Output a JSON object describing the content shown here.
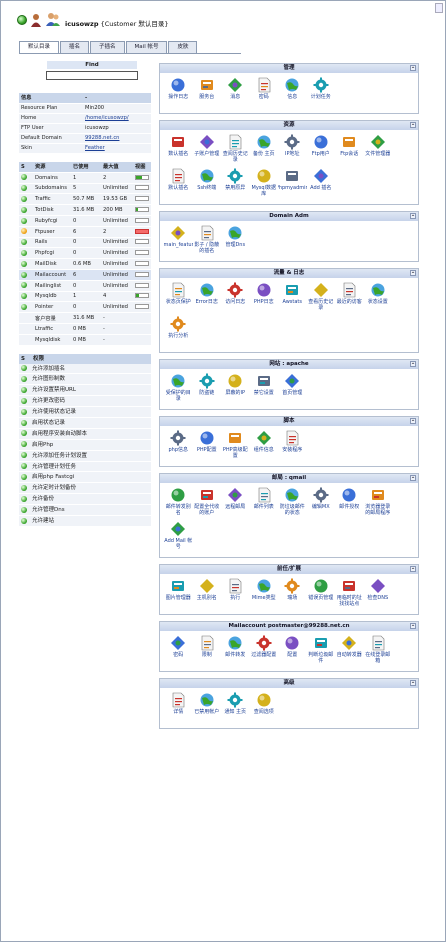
{
  "header": {
    "username": "icusowzp",
    "subtitle": "{Customer 默认目录}"
  },
  "tabs": [
    "默认目录",
    "插名",
    "子插名",
    "Mail 帐号",
    "皮肤"
  ],
  "find": {
    "label": "Find",
    "value": ""
  },
  "info": {
    "header": [
      "信息",
      "-"
    ],
    "rows": [
      [
        "Resource Plan",
        "Min200"
      ],
      [
        "Home",
        "/home/icusowzp/"
      ],
      [
        "FTP User",
        "icusowzp"
      ],
      [
        "Default Domain",
        "99288.net.cn"
      ],
      [
        "Skin",
        "Feather"
      ]
    ]
  },
  "resources": {
    "header": [
      "S",
      "资源",
      "已使用",
      "最大值",
      "视图"
    ],
    "rows": [
      {
        "s": "g",
        "name": "Domains",
        "used": "1",
        "max": "2",
        "bar": 0.5
      },
      {
        "s": "g",
        "name": "Subdomains",
        "used": "5",
        "max": "Unlimited",
        "bar": 0
      },
      {
        "s": "g",
        "name": "Traffic",
        "used": "50.7 MB",
        "max": "19.53 GB",
        "bar": 0
      },
      {
        "s": "g",
        "name": "TotDisk",
        "used": "31.6 MB",
        "max": "200 MB",
        "bar": 0.15
      },
      {
        "s": "g",
        "name": "Rubyfcgi",
        "used": "0",
        "max": "Unlimited",
        "bar": 0
      },
      {
        "s": "o",
        "name": "Ftpuser",
        "used": "6",
        "max": "2",
        "bar": 1
      },
      {
        "s": "g",
        "name": "Rails",
        "used": "0",
        "max": "Unlimited",
        "bar": 0
      },
      {
        "s": "g",
        "name": "Phpfcgi",
        "used": "0",
        "max": "Unlimited",
        "bar": 0
      },
      {
        "s": "g",
        "name": "MailDisk",
        "used": "0.6 MB",
        "max": "Unlimited",
        "bar": 0
      },
      {
        "s": "g",
        "name": "Mailaccount",
        "used": "6",
        "max": "Unlimited",
        "bar": 0
      },
      {
        "s": "g",
        "name": "Mailinglist",
        "used": "0",
        "max": "Unlimited",
        "bar": 0
      },
      {
        "s": "g",
        "name": "Mysqldb",
        "used": "1",
        "max": "4",
        "bar": 0.25
      },
      {
        "s": "g",
        "name": "Pointer",
        "used": "0",
        "max": "Unlimited",
        "bar": 0
      },
      {
        "s": "n",
        "name": "客户容量",
        "used": "31.6 MB",
        "max": "-",
        "bar": -1
      },
      {
        "s": "n",
        "name": "Ltraffic",
        "used": "0 MB",
        "max": "-",
        "bar": -1
      },
      {
        "s": "n",
        "name": "Mysqldisk",
        "used": "0 MB",
        "max": "-",
        "bar": -1
      }
    ]
  },
  "permissions": {
    "header": [
      "S",
      "权限"
    ],
    "items": [
      "允许添加插名",
      "允许图形制数",
      "允许设置禁用URL",
      "允许更改密码",
      "允许使用状态记录",
      "启用状态记录",
      "启用程序安装自动脚本",
      "启用Php",
      "允许添加任务计划设置",
      "允许管理计划任务",
      "启用php Fastcgi",
      "允许定时计划备份",
      "允许备份",
      "允许管理Dns",
      "允许建站"
    ]
  },
  "panels": [
    {
      "title": "管理",
      "items": [
        "操作日志",
        "服务台",
        "消息",
        "密码",
        "信息",
        "计划任务"
      ]
    },
    {
      "title": "资源",
      "items": [
        "数认插名",
        "子账户管理",
        "查阅历史记录",
        "备份 主页",
        "IP地址",
        "Ftp用户",
        "Ftp会话",
        "文件管理器",
        "默认插名",
        "Ssh终端",
        "禁用原异",
        "Mysql数据库",
        "Phpmyadmin",
        "Add 插名"
      ]
    },
    {
      "title": "Domain Adm",
      "items": [
        "domain_features",
        "影子 / 隐蔽的插名",
        "管理Dns"
      ]
    },
    {
      "title": "流量 & 日志",
      "items": [
        "状态页保护",
        "Error日志",
        "访问日志",
        "PHP日志",
        "Awstats",
        "查看历史记录",
        "最近的访客",
        "状态设置",
        "执行分析"
      ]
    },
    {
      "title": "网站 : apache",
      "items": [
        "受保护的目录",
        "防盗链",
        "屏蔽的IP",
        "禁它设置",
        "首页管理"
      ]
    },
    {
      "title": "脚本",
      "items": [
        "php信息",
        "PHP配置",
        "PHP高级配置",
        "组件信息",
        "安装程序"
      ]
    },
    {
      "title": "邮局 : qmail",
      "items": [
        "邮件转发别名",
        "配置全代收的账户",
        "远程邮局",
        "邮件列表",
        "防垃圾邮件的状态",
        "编辑MX",
        "邮件授权",
        "浏览器登录的邮局程序",
        "Add Mail 帐号"
      ]
    },
    {
      "title": "前任/扩展",
      "items": [
        "图片管理器",
        "主机别名",
        "执行",
        "Mime类型",
        "瑞场",
        "错误页管理",
        "用临时的址找找站点",
        "检查DNS"
      ]
    },
    {
      "title": "Mailaccount postmaster@99288.net.cn",
      "items": [
        "密码",
        "限制",
        "邮件转发",
        "过滤器配置",
        "配置",
        "判断垃圾邮件",
        "自动转发器",
        "在线登录邮箱"
      ]
    },
    {
      "title": "高级",
      "items": [
        "详情",
        "已禁用帐户",
        "通知 主页",
        "查阅选项"
      ]
    }
  ]
}
